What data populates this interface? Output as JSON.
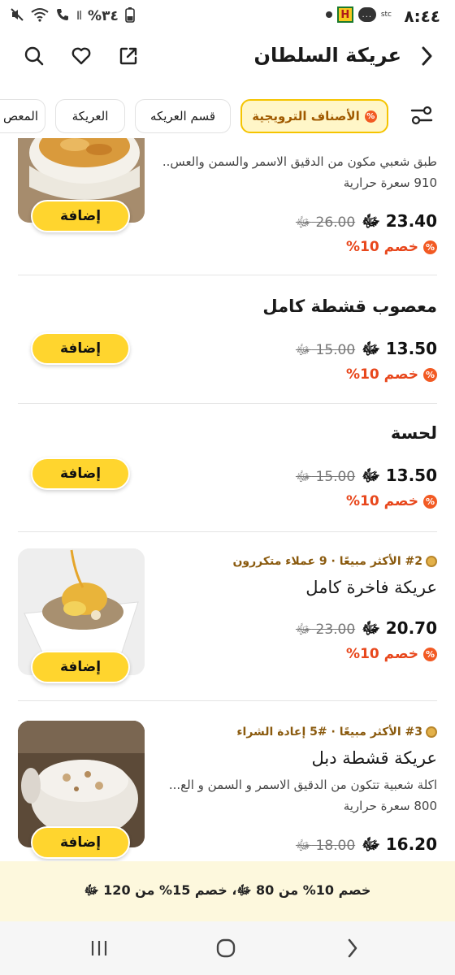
{
  "status": {
    "time": "٨:٤٤",
    "battery": "%٣٤",
    "carrier": "stc",
    "app_badge": "H",
    "chat_icon_text": "...",
    "signal": "Il"
  },
  "header": {
    "title": "عريكة السلطان",
    "icons": [
      "chevron-right-icon",
      "search-icon",
      "heart-icon",
      "share-icon"
    ]
  },
  "categories": [
    {
      "label": "الأصناف الترويجية",
      "active": true,
      "icon": "offer-icon"
    },
    {
      "label": "قسم العريكه",
      "active": false
    },
    {
      "label": "العريكة",
      "active": false
    },
    {
      "label": "المعص",
      "active": false
    }
  ],
  "offer_icon_text": "%",
  "currency": "ﷻ",
  "items": [
    {
      "name": "",
      "desc": "طبق شعبي مكون من الدقيق الاسمر والسمن والعس..",
      "calories": "910 سعرة حرارية",
      "price": "23.40",
      "old_price": "26.00",
      "discount": "خصم 10%",
      "add_label": "إضافة"
    },
    {
      "name": "معصوب قشطة كامل",
      "price": "13.50",
      "old_price": "15.00",
      "discount": "خصم 10%",
      "add_label": "إضافة"
    },
    {
      "name": "لحسة",
      "price": "13.50",
      "old_price": "15.00",
      "discount": "خصم 10%",
      "add_label": "إضافة"
    },
    {
      "badge": "#2 الأكثر مبيعًا · 9 عملاء متكررون",
      "name": "عريكة فاخرة كامل",
      "price": "20.70",
      "old_price": "23.00",
      "discount": "خصم 10%",
      "add_label": "إضافة"
    },
    {
      "badge": "#3 الأكثر مبيعًا · #5 إعادة الشراء",
      "name": "عريكة قشطة دبل",
      "desc": "اكلة شعبية تتكون من الدقيق الاسمر و السمن و الع...",
      "calories": "800 سعرة حرارية",
      "price": "16.20",
      "old_price": "18.00",
      "add_label": "إضافة"
    }
  ],
  "promo": {
    "text": "خصم 10% من 80 ﷻ، خصم 15% من 120 ﷻ"
  },
  "navbar": {
    "recents": "|||",
    "home": "○",
    "back": "‹"
  },
  "colors": {
    "accent_yellow": "#ffd52e",
    "discount_orange": "#e8471c",
    "promo_bg": "#fdf8dd",
    "active_chip_bg": "#fff6c8"
  }
}
